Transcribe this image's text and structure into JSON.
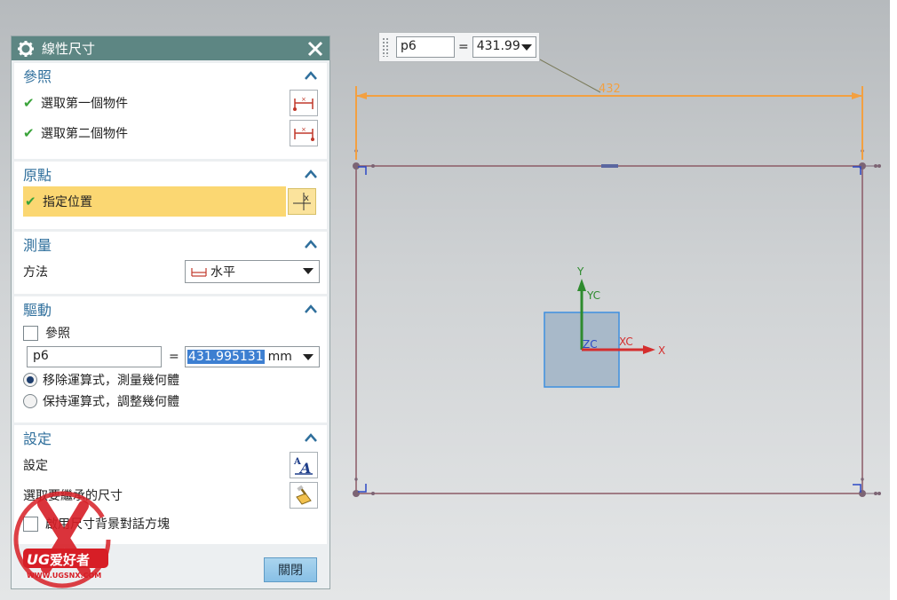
{
  "dialog": {
    "title": "線性尺寸",
    "sections": {
      "reference": {
        "title": "參照",
        "first_object": "選取第一個物件",
        "second_object": "選取第二個物件"
      },
      "origin": {
        "title": "原點",
        "specify_location": "指定位置"
      },
      "measure": {
        "title": "測量",
        "method_label": "方法",
        "method_value": "水平"
      },
      "driving": {
        "title": "驅動",
        "reference_checkbox": "參照",
        "name_value": "p6",
        "equals": "=",
        "value": "431.995131",
        "unit": "mm",
        "radio_remove": "移除運算式，測量幾何體",
        "radio_keep": "保持運算式，調整幾何體"
      },
      "settings": {
        "title": "設定",
        "settings_label": "設定",
        "select_dims_label": "選取要繼承的尺寸",
        "checkbox_label": "啟用尺寸背景對話方塊"
      }
    },
    "close_label": "關閉"
  },
  "float_input": {
    "name": "p6",
    "equals": "=",
    "value": "431.99"
  },
  "canvas": {
    "dimension_value": "432",
    "axes": {
      "y": "Y",
      "yc": "YC",
      "x": "X",
      "xc": "XC",
      "zc": "ZC"
    }
  },
  "watermark": {
    "brand": "UG爱好者",
    "url": "WWW.UGSNX.COM"
  },
  "colors": {
    "title_bar": "#5d8683",
    "section_title": "#2f6f9c",
    "selected_row": "#fbd772",
    "dimension": "#f3a041",
    "sketch_line": "#8b5a66",
    "csys_square": "#3d8fe0",
    "y_axis": "#2e8b2e",
    "x_axis": "#d42e2e",
    "watermark": "#d71e26"
  }
}
